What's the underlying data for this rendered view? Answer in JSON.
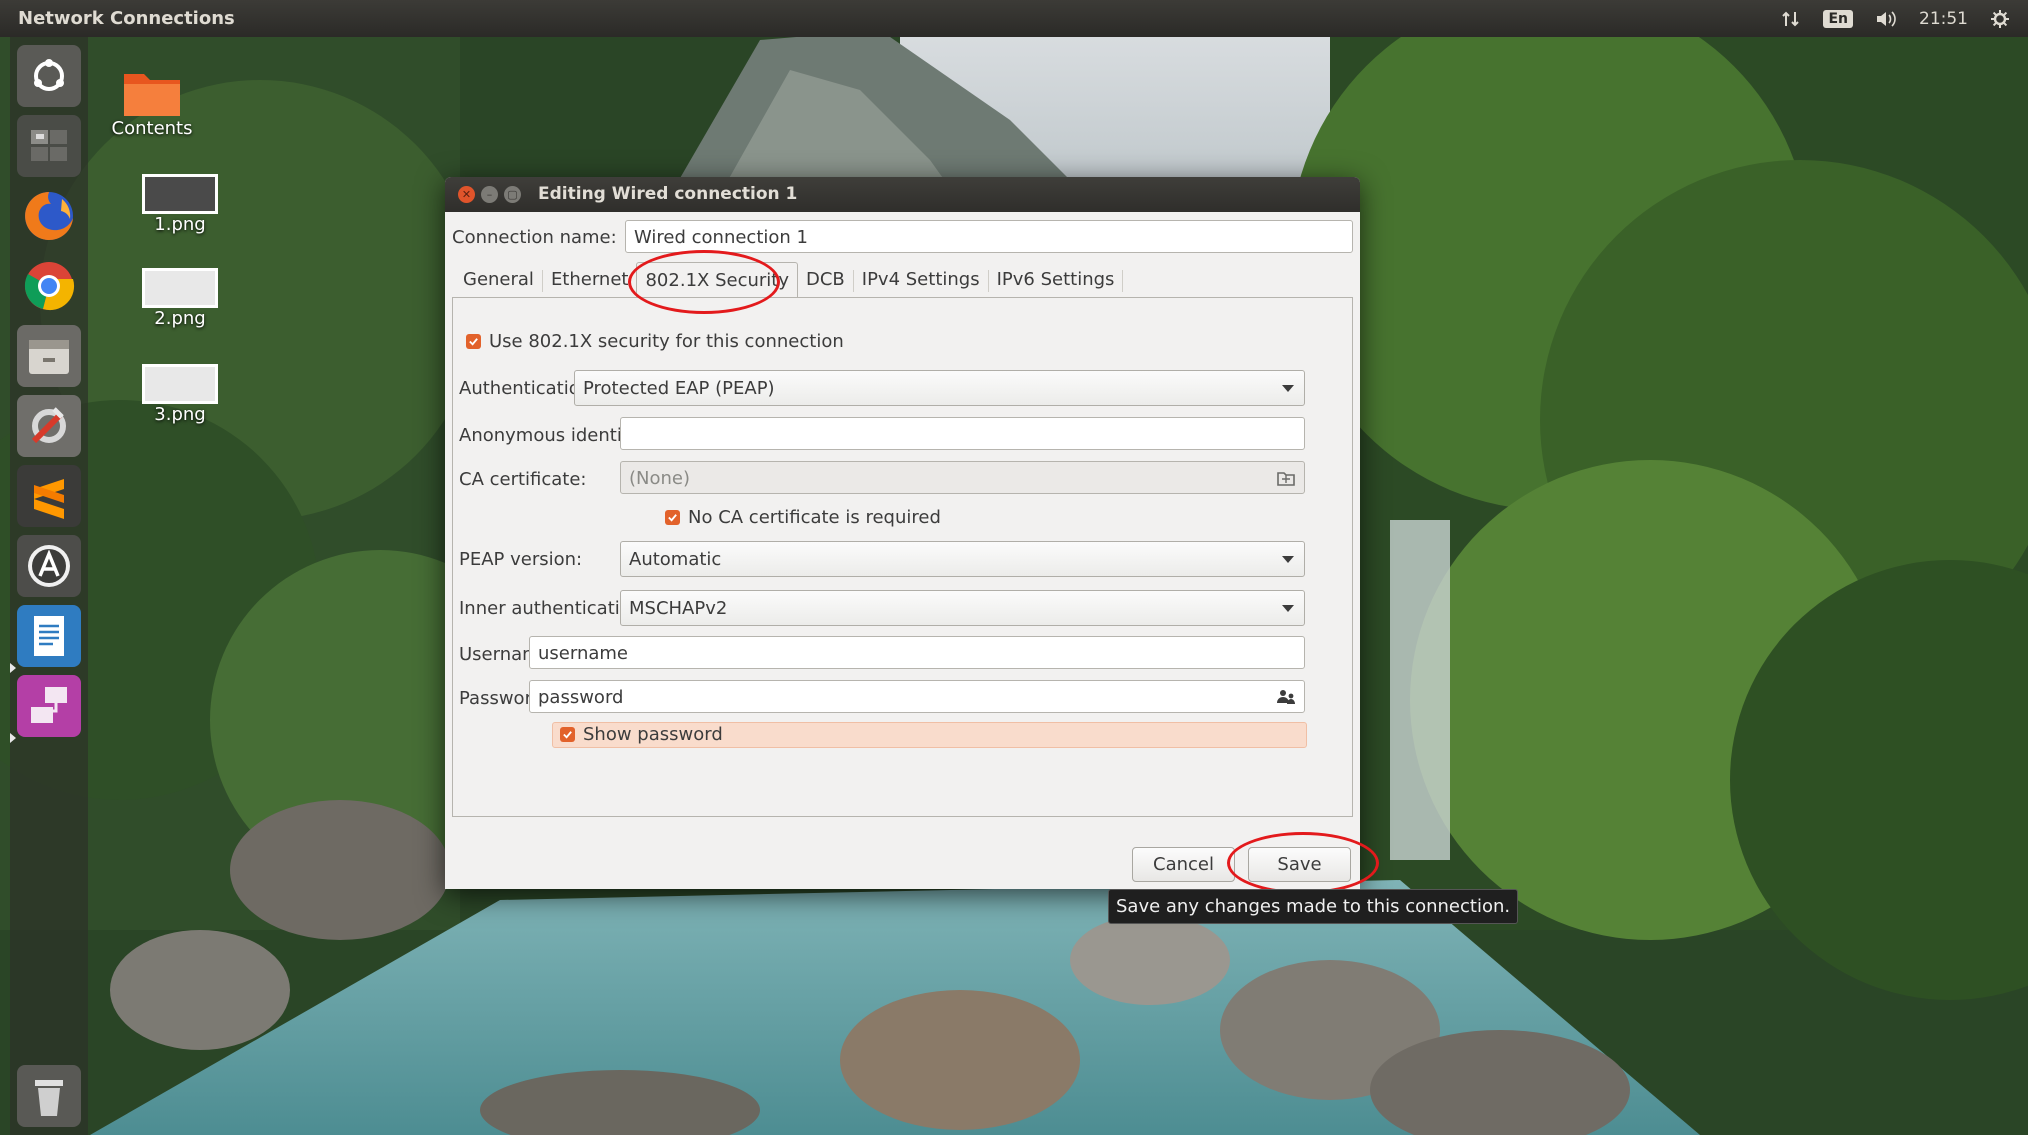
{
  "panel": {
    "app_title": "Network Connections",
    "language": "En",
    "clock": "21:51"
  },
  "launcher": {
    "items": [
      {
        "name": "dash-home-icon"
      },
      {
        "name": "workspace-switcher-icon"
      },
      {
        "name": "firefox-icon"
      },
      {
        "name": "chrome-icon"
      },
      {
        "name": "file-manager-icon"
      },
      {
        "name": "system-settings-icon"
      },
      {
        "name": "sublime-text-icon"
      },
      {
        "name": "software-updater-icon"
      },
      {
        "name": "text-editor-icon"
      },
      {
        "name": "network-connections-icon"
      },
      {
        "name": "trash-icon"
      }
    ]
  },
  "desktop": {
    "icons": [
      {
        "label": "Contents"
      },
      {
        "label": "1.png"
      },
      {
        "label": "2.png"
      },
      {
        "label": "3.png"
      }
    ]
  },
  "dialog": {
    "title": "Editing Wired connection 1",
    "connection_name_label": "Connection name:",
    "connection_name_value": "Wired connection 1",
    "tabs": [
      {
        "label": "General",
        "active": false
      },
      {
        "label": "Ethernet",
        "active": false
      },
      {
        "label": "802.1X Security",
        "active": true
      },
      {
        "label": "DCB",
        "active": false
      },
      {
        "label": "IPv4 Settings",
        "active": false
      },
      {
        "label": "IPv6 Settings",
        "active": false
      }
    ],
    "use_8021x_label": "Use 802.1X security for this connection",
    "use_8021x_checked": true,
    "authentication_label": "Authentication:",
    "authentication_value": "Protected EAP (PEAP)",
    "anonymous_identity_label": "Anonymous identity:",
    "anonymous_identity_value": "",
    "ca_certificate_label": "CA certificate:",
    "ca_certificate_value": "(None)",
    "no_ca_required_label": "No CA certificate is required",
    "no_ca_required_checked": true,
    "peap_version_label": "PEAP version:",
    "peap_version_value": "Automatic",
    "inner_auth_label": "Inner authentication:",
    "inner_auth_value": "MSCHAPv2",
    "username_label": "Username:",
    "username_value": "username",
    "password_label": "Password:",
    "password_value": "password",
    "show_password_label": "Show password",
    "show_password_checked": true,
    "cancel_label": "Cancel",
    "save_label": "Save",
    "save_tooltip": "Save any changes made to this connection."
  },
  "colors": {
    "accent_orange": "#e2622b",
    "annotation_red": "#e31a1c",
    "panel_bg": "#2b2a27",
    "dialog_bg": "#f2f1f0"
  }
}
